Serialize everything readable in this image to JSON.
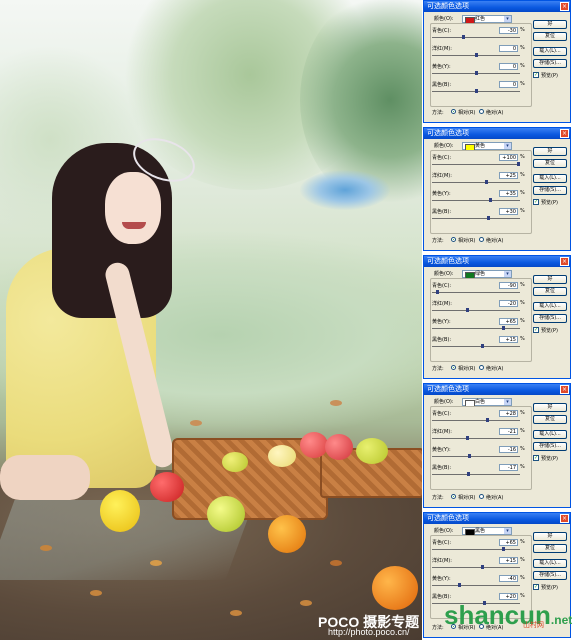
{
  "watermark": {
    "logo": "POCO 摄影专题",
    "url": "http://photo.poco.cn/"
  },
  "brand": {
    "logo": "shancun",
    "suffix": ".net",
    "cn": "山村网"
  },
  "dialog_common": {
    "title": "可选颜色选项",
    "colors_label": "颜色(O):",
    "cyan_label": "青色(C):",
    "magenta_label": "洋红(M):",
    "yellow_label": "黄色(Y):",
    "black_label": "黑色(B):",
    "pct": "%",
    "ok": "好",
    "reset": "复位",
    "load": "载入(L)...",
    "save": "存储(S)...",
    "preview": "预览(P)",
    "method_label": "方法:",
    "relative": "相对(R)",
    "absolute": "绝对(A)"
  },
  "panels": [
    {
      "color_name": "红色",
      "swatch": "#d01818",
      "cyan": "-30",
      "magenta": "0",
      "yellow": "0",
      "black": "0",
      "cyan_v": -30,
      "magenta_v": 0,
      "yellow_v": 0,
      "black_v": 0
    },
    {
      "color_name": "黄色",
      "swatch": "#ffff00",
      "cyan": "+100",
      "magenta": "+25",
      "yellow": "+35",
      "black": "+30",
      "cyan_v": 100,
      "magenta_v": 25,
      "yellow_v": 35,
      "black_v": 30
    },
    {
      "color_name": "绿色",
      "swatch": "#107820",
      "cyan": "-90",
      "magenta": "-20",
      "yellow": "+65",
      "black": "+15",
      "cyan_v": -90,
      "magenta_v": -20,
      "yellow_v": 65,
      "black_v": 15
    },
    {
      "color_name": "白色",
      "swatch": "#ffffff",
      "cyan": "+28",
      "magenta": "-21",
      "yellow": "-16",
      "black": "-17",
      "cyan_v": 28,
      "magenta_v": -21,
      "yellow_v": -16,
      "black_v": -17
    },
    {
      "color_name": "黑色",
      "swatch": "#000000",
      "cyan": "+65",
      "magenta": "+15",
      "yellow": "-40",
      "black": "+20",
      "cyan_v": 65,
      "magenta_v": 15,
      "yellow_v": -40,
      "black_v": 20
    }
  ]
}
